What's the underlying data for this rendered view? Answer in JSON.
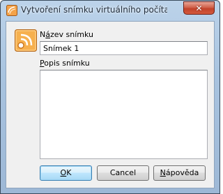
{
  "window": {
    "title": "Vytvoření snímku virtuálního počítače",
    "close_glyph": "✕",
    "app_icon": "virtualbox-icon"
  },
  "form": {
    "snapshot_icon": "snapshot-icon",
    "name_label_pre": "N",
    "name_label_mnemonic": "á",
    "name_label_post": "zev snímku",
    "name_value": "Snímek 1",
    "desc_label_mnemonic": "P",
    "desc_label_post": "opis snímku",
    "desc_value": ""
  },
  "buttons": {
    "ok_mnemonic": "O",
    "ok_post": "K",
    "cancel_label": "Cancel",
    "help_mnemonic": "N",
    "help_post": "ápověda"
  },
  "colors": {
    "title_bar": "#a8c3df",
    "close_button": "#c2422a",
    "default_button": "#bee6fd",
    "client_bg": "#f0f0f0"
  }
}
